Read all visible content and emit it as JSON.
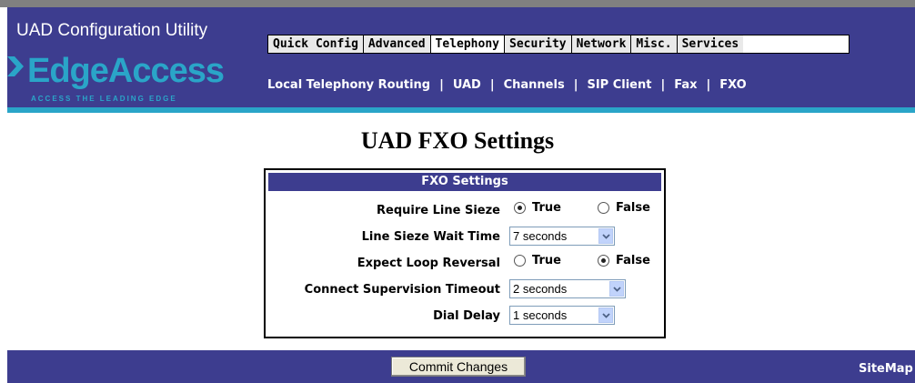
{
  "app": {
    "title": "UAD Configuration Utility"
  },
  "logo": {
    "name": "EdgeAccess",
    "tagline": "ACCESS THE LEADING EDGE"
  },
  "tabs": [
    {
      "label": "Quick Config"
    },
    {
      "label": "Advanced"
    },
    {
      "label": "Telephony"
    },
    {
      "label": "Security"
    },
    {
      "label": "Network"
    },
    {
      "label": "Misc."
    },
    {
      "label": "Services"
    }
  ],
  "subnav": [
    {
      "label": "Local Telephony Routing"
    },
    {
      "label": "UAD"
    },
    {
      "label": "Channels"
    },
    {
      "label": "SIP Client"
    },
    {
      "label": "Fax"
    },
    {
      "label": "FXO"
    }
  ],
  "subnav_sep": "|",
  "page": {
    "title": "UAD FXO Settings"
  },
  "panel": {
    "title": "FXO Settings",
    "require_line_sieze": {
      "label": "Require Line Sieze",
      "option_true": "True",
      "option_false": "False",
      "selected": "True"
    },
    "line_sieze_wait_time": {
      "label": "Line Sieze Wait Time",
      "value": "7 seconds"
    },
    "expect_loop_reversal": {
      "label": "Expect Loop Reversal",
      "option_true": "True",
      "option_false": "False",
      "selected": "False"
    },
    "connect_supervision_timeout": {
      "label": "Connect Supervision Timeout",
      "value": "2 seconds"
    },
    "dial_delay": {
      "label": "Dial Delay",
      "value": "1 seconds"
    }
  },
  "footer": {
    "commit_label": "Commit Changes",
    "sitemap_label": "SiteMap"
  },
  "colors": {
    "header_bg": "#3d3d8f",
    "accent": "#2aa5c8"
  }
}
